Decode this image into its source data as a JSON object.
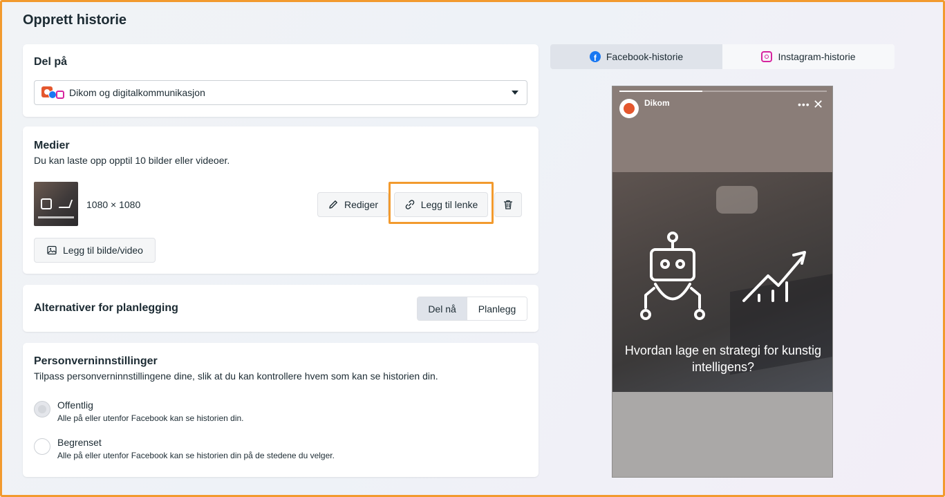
{
  "page": {
    "title": "Opprett historie"
  },
  "share": {
    "title": "Del på",
    "account": "Dikom og digitalkommunikasjon"
  },
  "media": {
    "title": "Medier",
    "subtitle": "Du kan laste opp opptil 10 bilder eller videoer.",
    "dimensions": "1080 × 1080",
    "edit_label": "Rediger",
    "add_link_label": "Legg til lenke",
    "add_media_label": "Legg til bilde/video"
  },
  "schedule": {
    "title": "Alternativer for planlegging",
    "options": [
      "Del nå",
      "Planlegg"
    ],
    "selected": "Del nå"
  },
  "privacy": {
    "title": "Personverninnstillinger",
    "subtitle": "Tilpass personverninnstillingene dine, slik at du kan kontrollere hvem som kan se historien din.",
    "options": [
      {
        "label": "Offentlig",
        "description": "Alle på eller utenfor Facebook kan se historien din.",
        "selected": true
      },
      {
        "label": "Begrenset",
        "description": "Alle på eller utenfor Facebook kan se historien din på de stedene du velger.",
        "selected": false
      }
    ]
  },
  "preview": {
    "tabs": [
      {
        "label": "Facebook-historie",
        "icon": "facebook-icon",
        "active": true
      },
      {
        "label": "Instagram-historie",
        "icon": "instagram-icon",
        "active": false
      }
    ],
    "story_account": "Dikom",
    "story_text": "Hvordan lage en strategi for kunstig intelligens?",
    "progress": 0.4
  },
  "colors": {
    "highlight": "#f29a2e",
    "facebook_blue": "#1877f2",
    "instagram_pink": "#d6249f",
    "brand_orange": "#e4572e"
  }
}
